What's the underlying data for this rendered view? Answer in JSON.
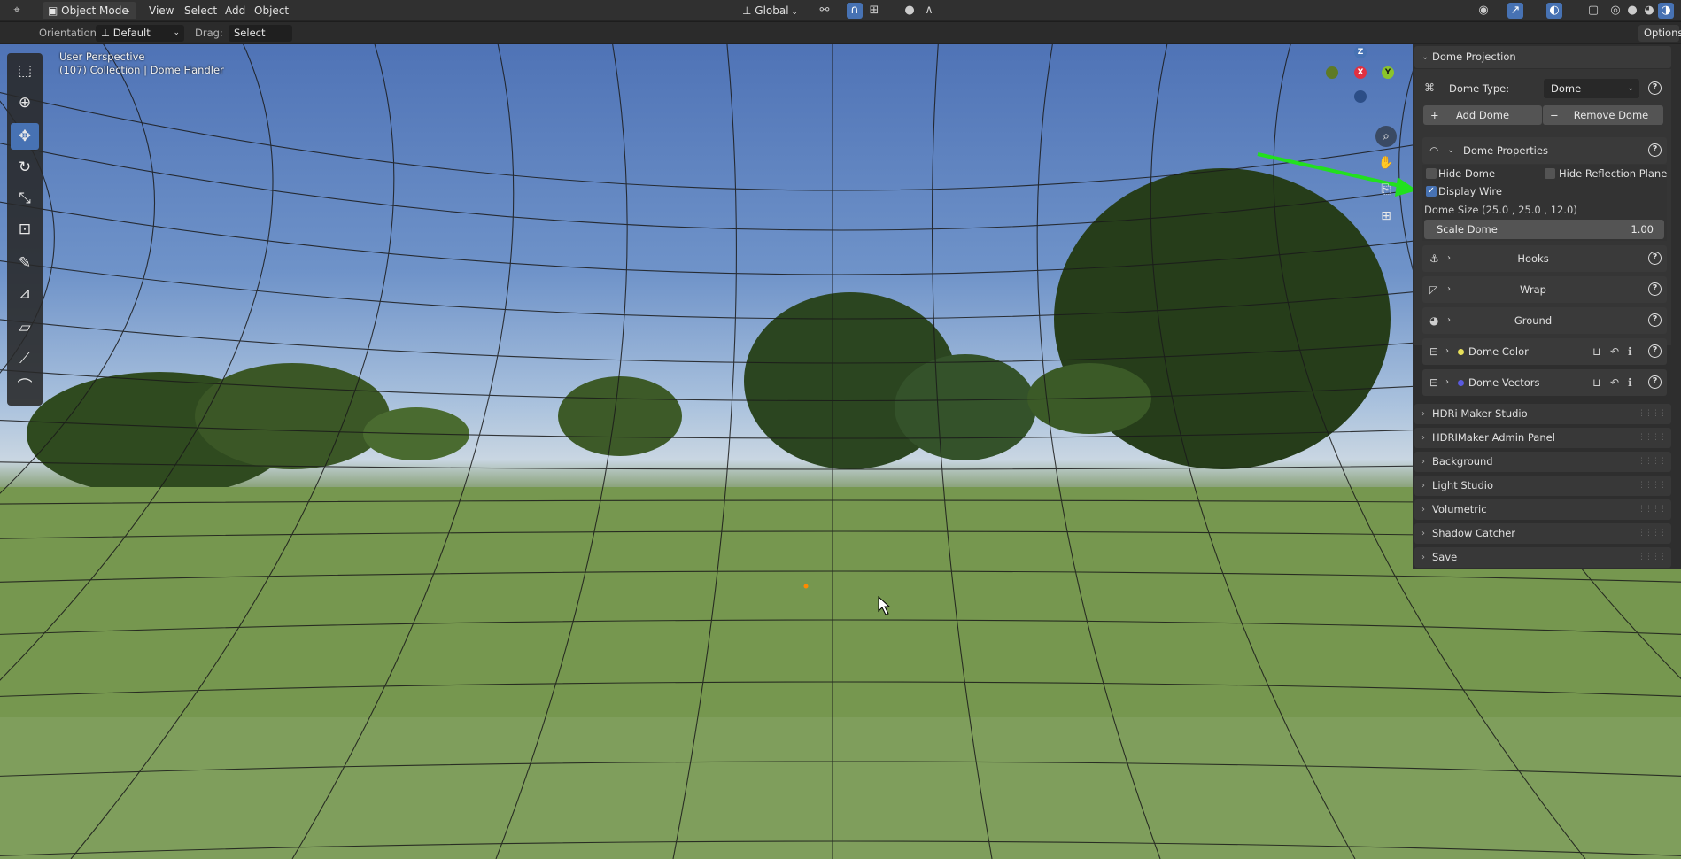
{
  "header": {
    "mode": "Object Mode",
    "menus": [
      "View",
      "Select",
      "Add",
      "Object"
    ],
    "transform_orientation": "Global"
  },
  "tool_settings": {
    "orientation_label": "Orientation:",
    "orientation_value": "Default",
    "drag_label": "Drag:",
    "drag_value": "Select Box",
    "options_label": "Options"
  },
  "viewport": {
    "view_name": "User Perspective",
    "collection_info": "(107) Collection | Dome Handler",
    "gizmo": {
      "z": "Z",
      "x": "X",
      "y": "Y"
    }
  },
  "sidebar": {
    "dome_projection": {
      "title": "Dome Projection",
      "dome_type_label": "Dome Type:",
      "dome_type_value": "Dome",
      "add_dome": "Add Dome",
      "remove_dome": "Remove Dome"
    },
    "dome_properties": {
      "title": "Dome Properties",
      "hide_dome": "Hide Dome",
      "hide_reflection_plane": "Hide Reflection Plane",
      "display_wire": "Display Wire",
      "dome_size": "Dome Size (25.0 , 25.0 , 12.0)",
      "scale_dome_label": "Scale Dome",
      "scale_dome_value": "1.00"
    },
    "subpanels": [
      "Hooks",
      "Wrap",
      "Ground",
      "Dome Color",
      "Dome Vectors"
    ],
    "panels": [
      "HDRi Maker Studio",
      "HDRIMaker Admin Panel",
      "Background",
      "Light Studio",
      "Volumetric",
      "Shadow Catcher",
      "Save"
    ]
  },
  "colors": {
    "accent": "#4772b3",
    "highlight_annotation": "#22e01e",
    "dome_color_dot": "#e8e05a",
    "dome_vectors_dot": "#5a5ae0"
  }
}
